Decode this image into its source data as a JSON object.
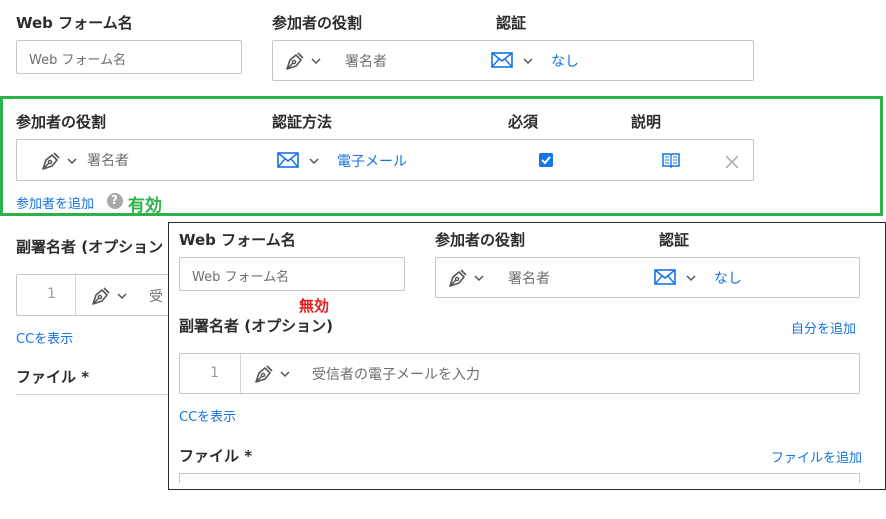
{
  "top": {
    "webform_label": "Web フォーム名",
    "webform_placeholder": "Web フォーム名",
    "role_label": "参加者の役割",
    "role_value": "署名者",
    "auth_label": "認証",
    "auth_value": "なし"
  },
  "valid_section": {
    "role_label": "参加者の役割",
    "auth_label": "認証方法",
    "required_label": "必須",
    "desc_label": "説明",
    "role_value": "署名者",
    "auth_value": "電子メール",
    "required_checked": true,
    "add_participant": "参加者を追加",
    "status": "有効",
    "frame_color": "#2fb14a"
  },
  "background_section": {
    "cosigner_label": "副署名者 (オプション",
    "number": "1",
    "recipient_partial": "受",
    "show_cc": "CCを表示",
    "file_label": "ファイル *"
  },
  "overlay": {
    "webform_label": "Web フォーム名",
    "webform_placeholder": "Web フォーム名",
    "role_label": "参加者の役割",
    "role_value": "署名者",
    "auth_label": "認証",
    "auth_value": "なし",
    "invalid_label": "無効",
    "cosigner_label": "副署名者 (オプション)",
    "add_self": "自分を追加",
    "number": "1",
    "recipient_placeholder": "受信者の電子メールを入力",
    "show_cc": "CCを表示",
    "file_label": "ファイル *",
    "add_file": "ファイルを追加"
  },
  "colors": {
    "accent": "#1473e6",
    "valid": "#2fb14a",
    "invalid": "#e02020"
  }
}
